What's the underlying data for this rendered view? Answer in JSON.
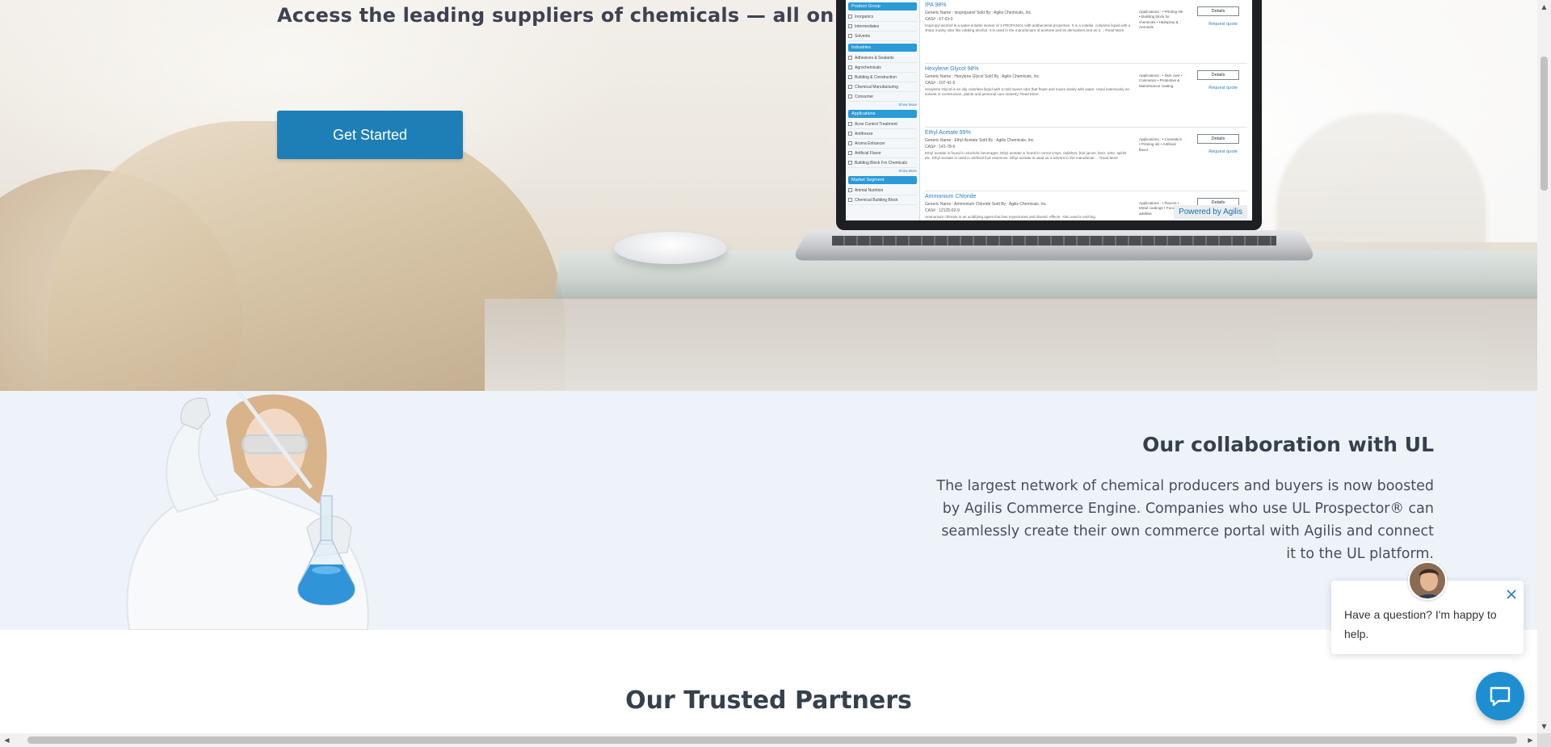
{
  "hero": {
    "subtitle": "Access the leading suppliers of chemicals — all on one platform",
    "cta_label": "Get Started",
    "laptop": {
      "filters": [
        {
          "heading": "Product Group",
          "items": [
            "Inorganics",
            "Intermediates",
            "Solvents"
          ]
        },
        {
          "heading": "Industries",
          "items": [
            "Adhesives & Sealants",
            "Agrochemicals",
            "Building & Construction",
            "Chemical Manufacturing",
            "Consumer"
          ],
          "more": "Show More"
        },
        {
          "heading": "Applications",
          "items": [
            "Acne Control Treatment",
            "Antifreeze",
            "Aroma Enhancer",
            "Artificial Flavor",
            "Building Block For Chemicals"
          ],
          "more": "Show More"
        },
        {
          "heading": "Market Segment",
          "items": [
            "Animal Nutrition",
            "Chemical Building Block"
          ]
        }
      ],
      "results": [
        {
          "title": "IPA 98%",
          "generic": "Generic Name : Isopropanol",
          "sold_by": "Sold By : Agilis Chemicals, Inc.",
          "cas": "CAS# : 67-63-0",
          "desc": "Isopropyl alcohol is a water-soluble isomer of 1-PROPANOL with antibacterial properties. It is a volatile, colorless liquid with a sharp musky odor like rubbing alcohol. It is used in the manufacture of acetone and its derivatives and as a ... Read More",
          "apps": "Applications : • Printing Ink • Building block for chemicals • Hairspray & Aerosols"
        },
        {
          "title": "Hexylene Glycol 98%",
          "generic": "Generic Name : Hexylene Glycol",
          "sold_by": "Sold By : Agilis Chemicals, Inc.",
          "cas": "CAS# : 107-41-5",
          "desc": "Hexylene Glycol is an oily colorless liquid with a mild sweet odor that floats and mixes slowly with water. Used extensively as solvent in construction, paints and personal care industry. Read More",
          "apps": "Applications : • Skin care • Cosmetics • Protective & Maintenance coating"
        },
        {
          "title": "Ethyl Acetate 99%",
          "generic": "Generic Name : Ethyl Acetate",
          "sold_by": "Sold By : Agilis Chemicals, Inc.",
          "cas": "CAS# : 141-78-6",
          "desc": "Ethyl acetate is found in alcoholic beverages. Ethyl acetate is found in cereal crops, radishes, fruit juices, beer, wine, spirits etc. Ethyl acetate is used in artificial fruit essences. Ethyl acetate is used as a solvent in the manufactur ... Read More",
          "apps": "Applications : • Cosmetics • Printing ink • Artificial flavor"
        },
        {
          "title": "Ammonium Chloride",
          "generic": "Generic Name : Ammonium Chloride",
          "sold_by": "Sold By : Agilis Chemicals, Inc.",
          "cas": "CAS# : 12125-02-9",
          "desc": "Ammonium chloride is an acidifying agent that has expectorant and diuretic effects. Also used in etching",
          "apps": "Applications : • Flavors • Metal coatings • Food additive"
        }
      ],
      "details_label": "Details",
      "quote_label": "Request quote",
      "powered_by": "Powered by Agilis"
    }
  },
  "collab": {
    "title": "Our collaboration with UL",
    "text": "The largest network of chemical producers and buyers is now boosted by Agilis Commerce Engine. Companies who use UL Prospector® can seamlessly create their own commerce portal with Agilis and connect it to the UL platform."
  },
  "partners": {
    "title": "Our Trusted Partners"
  },
  "chat": {
    "message": "Have a question? I'm happy to help.",
    "close_icon": "close-icon",
    "launcher_icon": "chat-bubble-icon",
    "accent": "#1d8fd1"
  },
  "colors": {
    "primary_button": "#1d7fb5",
    "collab_bg": "#eef3fa",
    "heading": "#36404d"
  }
}
